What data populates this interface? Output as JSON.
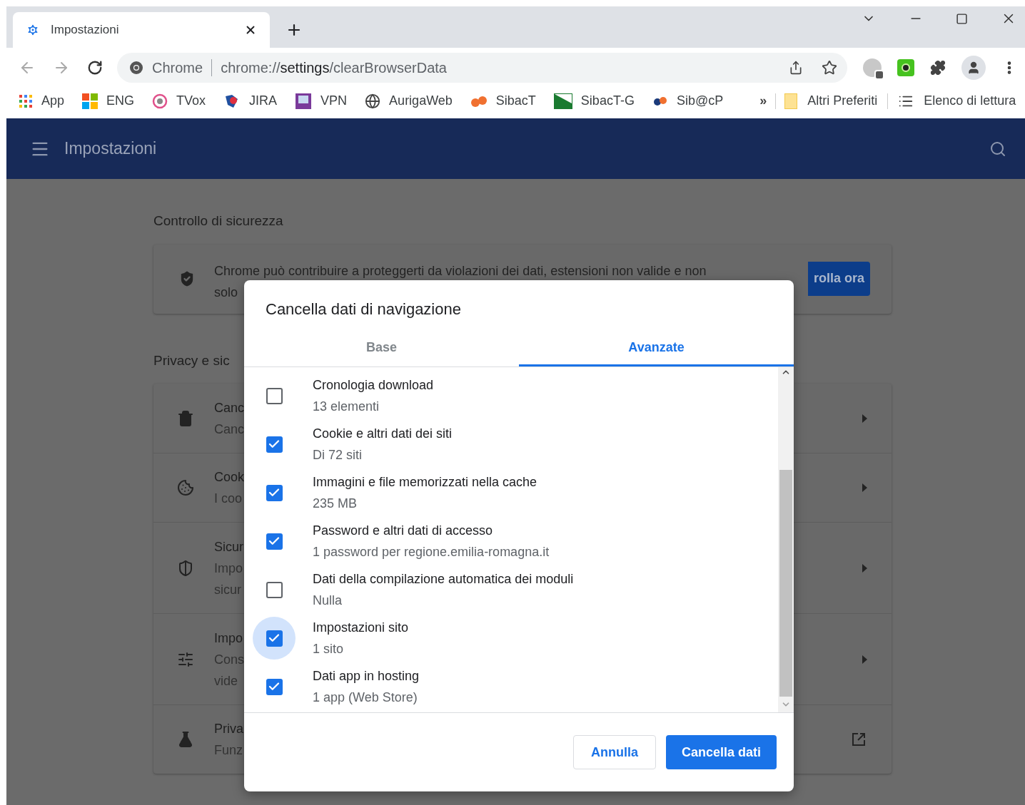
{
  "browser": {
    "tabs": [
      {
        "title": "Impostazioni",
        "selected": true
      }
    ]
  },
  "toolbar": {
    "omnibox": {
      "chip": "Chrome",
      "url_scheme": "chrome://",
      "url_host": "settings",
      "url_path": "/clearBrowserData"
    }
  },
  "bookmarks": {
    "items": [
      {
        "label": "App",
        "kind": "apps"
      },
      {
        "label": "ENG",
        "kind": "windows"
      },
      {
        "label": "TVox",
        "kind": "tvox"
      },
      {
        "label": "JIRA",
        "kind": "jira"
      },
      {
        "label": "VPN",
        "kind": "vpn"
      },
      {
        "label": "AurigaWeb",
        "kind": "globe"
      },
      {
        "label": "SibacT",
        "kind": "blobs"
      },
      {
        "label": "SibacT-G",
        "kind": "flag"
      },
      {
        "label": "Sib@cP",
        "kind": "dots"
      }
    ],
    "overflow": "»",
    "folder": "Altri Preferiti",
    "reading_list": "Elenco di lettura"
  },
  "settings": {
    "header_title": "Impostazioni",
    "safety": {
      "title": "Controllo di sicurezza",
      "lines": [
        "Chrome può contribuire a proteggerti da violazioni dei dati, estensioni non valide e non",
        "solo"
      ],
      "button": "rolla ora"
    },
    "privacy": {
      "title": "Privacy e sic",
      "rows": [
        {
          "kind": "trash",
          "lines": [
            "Canc",
            "Canc"
          ],
          "external": false
        },
        {
          "kind": "cookie",
          "lines": [
            "Cook",
            "I coo"
          ],
          "external": false
        },
        {
          "kind": "shield",
          "lines": [
            "Sicur",
            "Impo",
            "sicur"
          ],
          "external": false
        },
        {
          "kind": "sliders",
          "lines": [
            "Impo",
            "Cons",
            "vide"
          ],
          "external": false
        },
        {
          "kind": "flask",
          "lines": [
            "Priva",
            "Funz"
          ],
          "external": true
        }
      ]
    }
  },
  "dialog": {
    "title": "Cancella dati di navigazione",
    "tabs": [
      {
        "label": "Base",
        "selected": false
      },
      {
        "label": "Avanzate",
        "selected": true
      }
    ],
    "items": [
      {
        "title": "Cronologia download",
        "subtitle": "13 elementi",
        "checked": false,
        "focused": false
      },
      {
        "title": "Cookie e altri dati dei siti",
        "subtitle": "Di 72 siti",
        "checked": true,
        "focused": false
      },
      {
        "title": "Immagini e file memorizzati nella cache",
        "subtitle": "235 MB",
        "checked": true,
        "focused": false
      },
      {
        "title": "Password e altri dati di accesso",
        "subtitle": "1 password per regione.emilia-romagna.it",
        "checked": true,
        "focused": false
      },
      {
        "title": "Dati della compilazione automatica dei moduli",
        "subtitle": "Nulla",
        "checked": false,
        "focused": false
      },
      {
        "title": "Impostazioni sito",
        "subtitle": "1 sito",
        "checked": true,
        "focused": true
      },
      {
        "title": "Dati app in hosting",
        "subtitle": "1 app (Web Store)",
        "checked": true,
        "focused": false
      }
    ],
    "cancel_button": "Annulla",
    "confirm_button": "Cancella dati"
  }
}
